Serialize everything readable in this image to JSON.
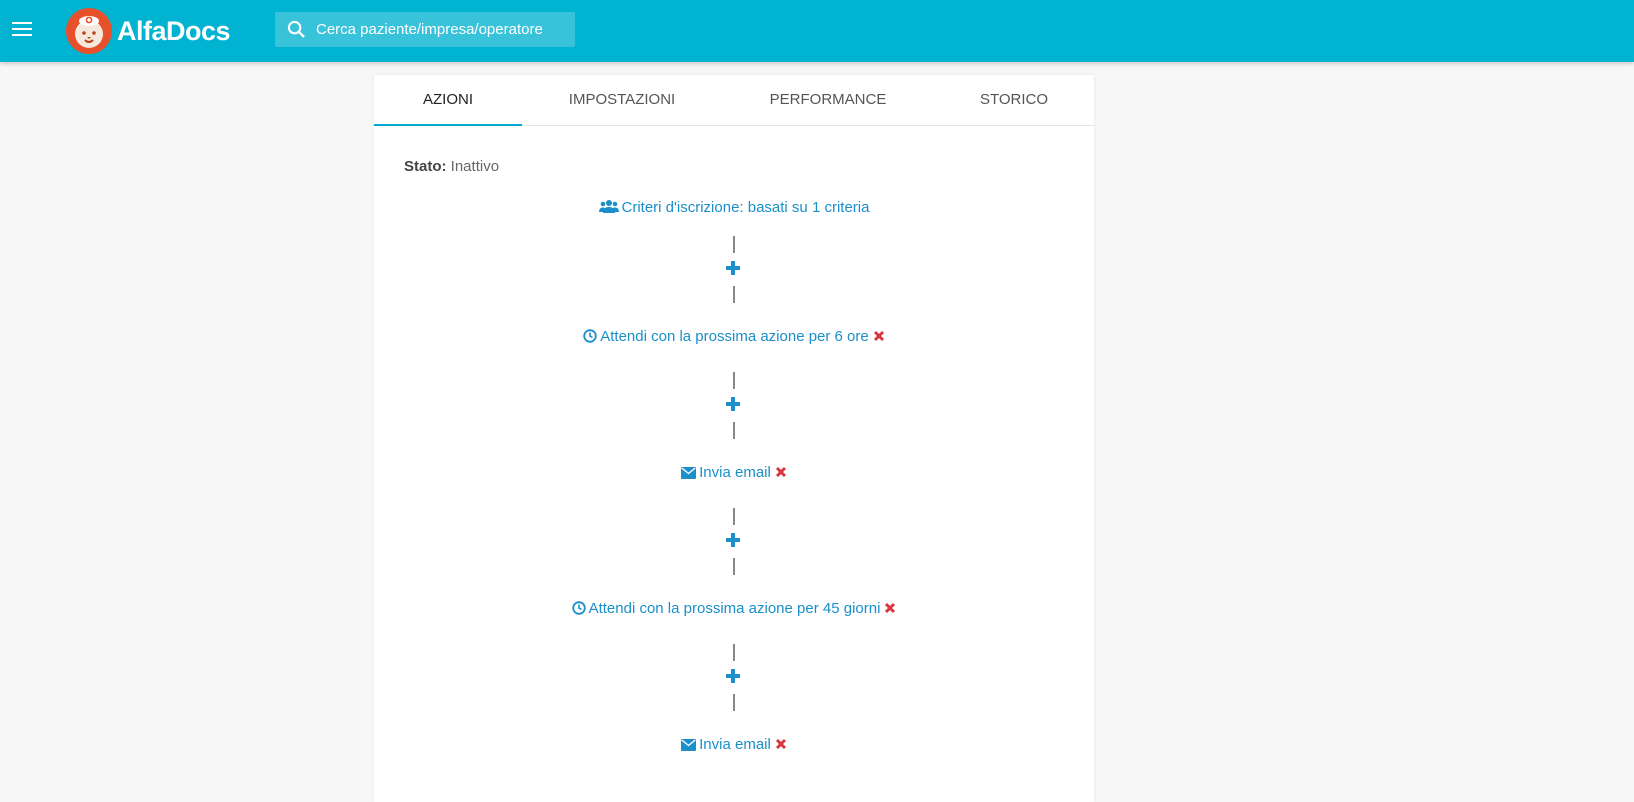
{
  "app": {
    "name": "AlfaDocs"
  },
  "search": {
    "placeholder": "Cerca paziente/impresa/operatore"
  },
  "tabs": [
    {
      "label": "AZIONI",
      "active": true
    },
    {
      "label": "IMPOSTAZIONI",
      "active": false
    },
    {
      "label": "PERFORMANCE",
      "active": false
    },
    {
      "label": "STORICO",
      "active": false
    }
  ],
  "status": {
    "label": "Stato:",
    "value": "Inattivo"
  },
  "flow": {
    "criteria": {
      "icon": "users-icon",
      "label": "Criteri d'iscrizione: basati su 1 criteria"
    },
    "actions": [
      {
        "icon": "clock-icon",
        "label": "Attendi con la prossima azione per 6 ore"
      },
      {
        "icon": "envelope-icon",
        "label": "Invia email"
      },
      {
        "icon": "clock-icon",
        "label": "Attendi con la prossima azione per 45 giorni"
      },
      {
        "icon": "envelope-icon",
        "label": "Invia email"
      }
    ]
  },
  "colors": {
    "topbar": "#00b3d1",
    "accent": "#00aacb",
    "link": "#1a8fc9",
    "delete": "#d9363e",
    "background": "#f7f7f7"
  }
}
